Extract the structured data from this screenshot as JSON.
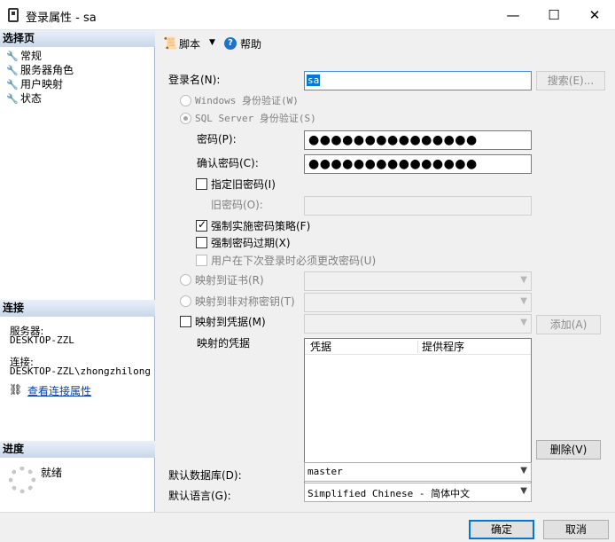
{
  "window": {
    "title": "登录属性 - sa",
    "minimize": "—",
    "maximize": "☐",
    "close": "✕"
  },
  "left": {
    "select_page_header": "选择页",
    "pages": [
      {
        "label": "常规",
        "icon": "wrench-icon"
      },
      {
        "label": "服务器角色",
        "icon": "wrench-icon"
      },
      {
        "label": "用户映射",
        "icon": "wrench-icon"
      },
      {
        "label": "状态",
        "icon": "wrench-icon"
      }
    ],
    "connection_header": "连接",
    "server_label": "服务器:",
    "server_value": "DESKTOP-ZZL",
    "conn_label": "连接:",
    "conn_value": "DESKTOP-ZZL\\zhongzhilong",
    "view_conn_link": "查看连接属性",
    "progress_header": "进度",
    "progress_status": "就绪"
  },
  "toolbar": {
    "script_label": "脚本",
    "help_label": "帮助"
  },
  "form": {
    "login_name_label": "登录名(N):",
    "login_name_value": "sa",
    "search_button": "搜索(E)...",
    "windows_auth": "Windows 身份验证(W)",
    "sql_auth": "SQL Server 身份验证(S)",
    "password_label": "密码(P):",
    "password_mask": "●●●●●●●●●●●●●●●",
    "confirm_label": "确认密码(C):",
    "confirm_mask": "●●●●●●●●●●●●●●●",
    "specify_old": "指定旧密码(I)",
    "old_password_label": "旧密码(O):",
    "enforce_policy": "强制实施密码策略(F)",
    "enforce_expiry": "强制密码过期(X)",
    "must_change": "用户在下次登录时必须更改密码(U)",
    "map_cert": "映射到证书(R)",
    "map_asym": "映射到非对称密钥(T)",
    "map_cred": "映射到凭据(M)",
    "add_button": "添加(A)",
    "mapped_creds_label": "映射的凭据",
    "cred_col": "凭据",
    "provider_col": "提供程序",
    "delete_button": "删除(V)",
    "default_db_label": "默认数据库(D):",
    "default_db_value": "master",
    "default_lang_label": "默认语言(G):",
    "default_lang_value": "Simplified Chinese - 简体中文"
  },
  "footer": {
    "ok": "确定",
    "cancel": "取消"
  }
}
